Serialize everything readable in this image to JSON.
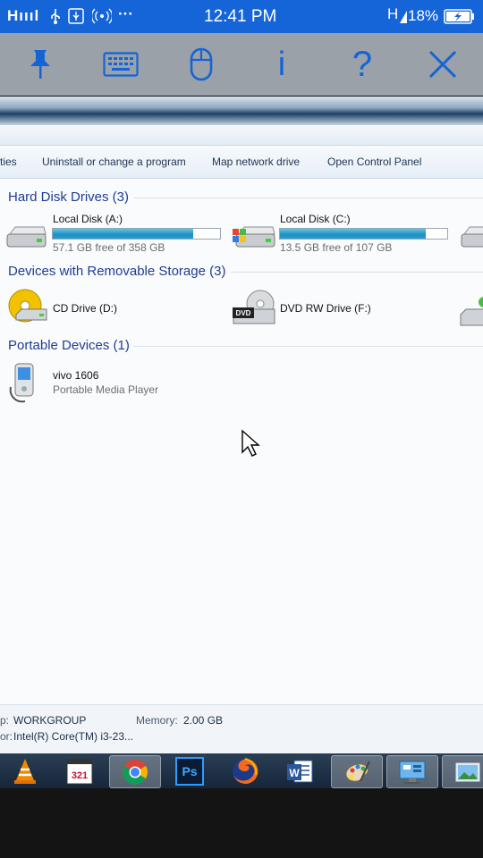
{
  "status_bar": {
    "signal": "Hıııl",
    "icons": [
      "usb-icon",
      "usb-debug-icon",
      "hotspot-icon",
      "more-icon"
    ],
    "more": "···",
    "time": "12:41 PM",
    "network": "H",
    "battery": "18%",
    "bg_color": "#1565d8"
  },
  "toolbar": {
    "items": [
      "pin-icon",
      "keyboard-icon",
      "mouse-icon",
      "info-icon",
      "help-icon",
      "close-icon"
    ],
    "info_label": "i",
    "help_label": "?",
    "accent_color": "#1464d6"
  },
  "command_bar": {
    "properties": "ties",
    "uninstall": "Uninstall or change a program",
    "map_drive": "Map network drive",
    "control_panel": "Open Control Panel"
  },
  "hard_disks": {
    "header": "Hard Disk Drives (3)",
    "items": [
      {
        "name": "Local Disk (A:)",
        "free": "57.1 GB free of 358 GB",
        "used_fraction": 0.84
      },
      {
        "name": "Local Disk (C:)",
        "free": "13.5 GB free of 107 GB",
        "used_fraction": 0.87
      }
    ]
  },
  "removable": {
    "header": "Devices with Removable Storage (3)",
    "items": [
      {
        "name": "CD Drive (D:)"
      },
      {
        "name": "DVD RW Drive (F:)",
        "badge": "DVD"
      }
    ]
  },
  "portable": {
    "header": "Portable Devices (1)",
    "items": [
      {
        "name": "vivo 1606",
        "type": "Portable Media Player"
      }
    ]
  },
  "details": {
    "workgroup_label": "p:",
    "workgroup_value": "WORKGROUP",
    "memory_label": "Memory:",
    "memory_value": "2.00 GB",
    "processor_label": "or:",
    "processor_value": "Intel(R) Core(TM) i3-23..."
  },
  "taskbar": {
    "apps": [
      "vlc-icon",
      "media-player-classic-icon",
      "chrome-icon",
      "photoshop-icon",
      "firefox-icon",
      "word-icon",
      "paint-icon",
      "control-panel-icon",
      "photo-viewer-icon"
    ],
    "mpc_label": "321",
    "photoshop_label": "Ps",
    "word_label": "W",
    "active": "chrome-icon"
  }
}
